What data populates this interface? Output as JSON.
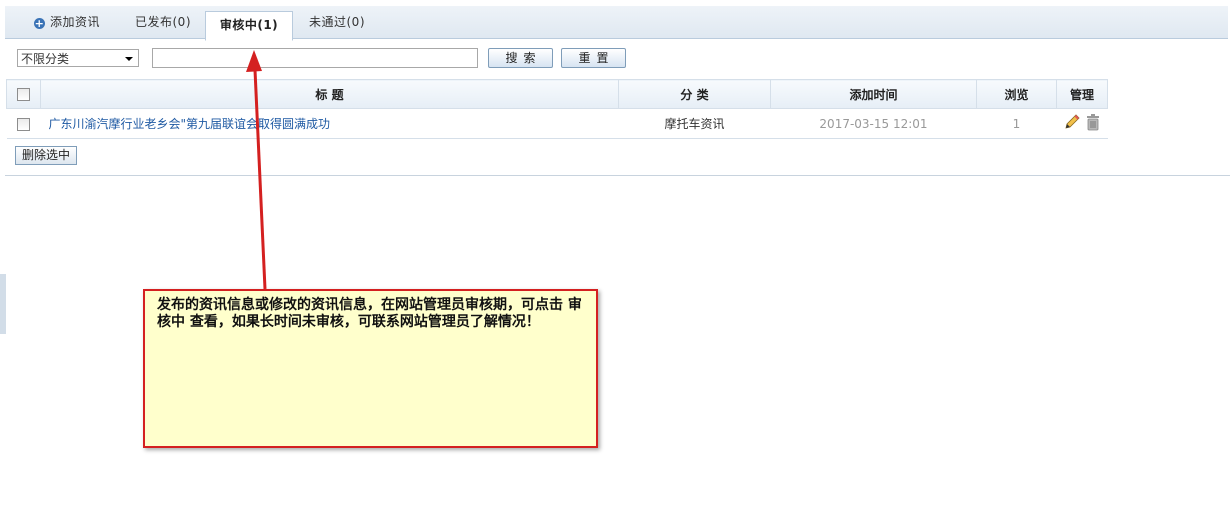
{
  "tabs": [
    {
      "label": "添加资讯",
      "icon": "plus-circle-icon"
    },
    {
      "label": "已发布(0)"
    },
    {
      "label": "审核中(1)",
      "active": true
    },
    {
      "label": "未通过(0)"
    }
  ],
  "filter": {
    "category_selected": "不限分类",
    "search_value": "",
    "search_button": "搜索",
    "reset_button": "重置"
  },
  "table": {
    "headers": [
      "标 题",
      "分 类",
      "添加时间",
      "浏览",
      "管理"
    ],
    "rows": [
      {
        "title": "广东川渝汽摩行业老乡会\"第九届联谊会取得圆满成功",
        "category": "摩托车资讯",
        "date": "2017-03-15 12:01",
        "views": "1"
      }
    ]
  },
  "delete_selected_button": "删除选中",
  "annotation": {
    "text": "发布的资讯信息或修改的资讯信息，在网站管理员审核期，可点击 审核中 查看，如果长时间未审核，可联系网站管理员了解情况！",
    "border_color": "#d42020",
    "bg_color": "#ffffcc"
  },
  "colors": {
    "accent": "#3a73b6",
    "link": "#1f5aa3",
    "arrow": "#d42020"
  }
}
